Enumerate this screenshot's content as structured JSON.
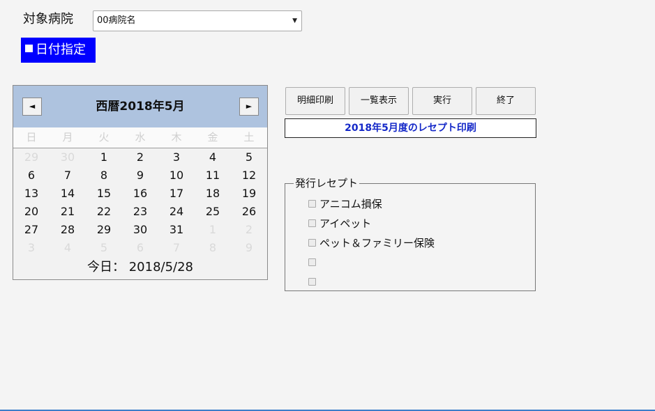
{
  "header": {
    "hospital_label": "対象病院",
    "hospital_selected": "00病院名",
    "date_toggle_label": "日付指定"
  },
  "calendar": {
    "title": "西暦2018年5月",
    "prev_glyph": "◄",
    "next_glyph": "►",
    "weekdays": [
      "日",
      "月",
      "火",
      "水",
      "木",
      "金",
      "土"
    ],
    "weeks": [
      [
        "29",
        "30",
        "1",
        "2",
        "3",
        "4",
        "5"
      ],
      [
        "6",
        "7",
        "8",
        "9",
        "10",
        "11",
        "12"
      ],
      [
        "13",
        "14",
        "15",
        "16",
        "17",
        "18",
        "19"
      ],
      [
        "20",
        "21",
        "22",
        "23",
        "24",
        "25",
        "26"
      ],
      [
        "27",
        "28",
        "29",
        "30",
        "31",
        "1",
        "2"
      ],
      [
        "3",
        "4",
        "5",
        "6",
        "7",
        "8",
        "9"
      ]
    ],
    "today_label": "今日：",
    "today_value": "2018/5/28"
  },
  "buttons": {
    "detail_print": "明細印刷",
    "list_view": "一覧表示",
    "execute": "実行",
    "exit": "終了"
  },
  "status_text": "2018年5月度のレセプト印刷",
  "receipts": {
    "legend": "発行レセプト",
    "options": [
      {
        "label": "アニコム損保",
        "checked": false
      },
      {
        "label": "アイペット",
        "checked": false
      },
      {
        "label": "ペット＆ファミリー保険",
        "checked": false
      },
      {
        "label": "",
        "checked": false
      },
      {
        "label": "",
        "checked": false
      }
    ]
  },
  "colors": {
    "toggle_bg": "#0000ff",
    "calendar_header": "#aec3df",
    "status_text": "#1428c8"
  }
}
